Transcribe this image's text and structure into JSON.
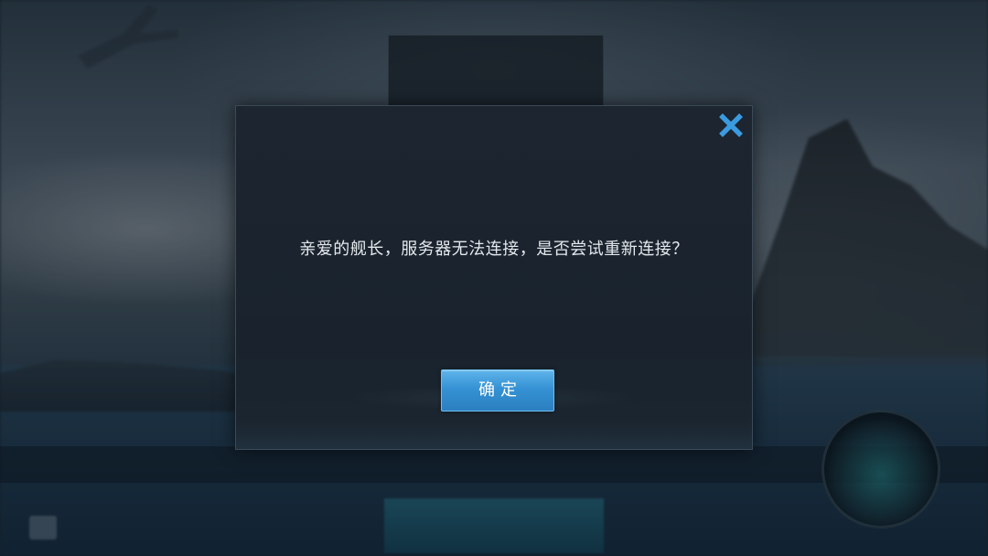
{
  "background": {
    "top_panel": {
      "title": "",
      "subtitle": ""
    },
    "bottom_hint": "",
    "bottom_button_label": "",
    "bottom_left_label": ""
  },
  "dialog": {
    "message": "亲爱的舰长，服务器无法连接，是否尝试重新连接？",
    "confirm_label": "确定",
    "close_icon": "close-icon",
    "accent_color": "#3a9be0"
  }
}
